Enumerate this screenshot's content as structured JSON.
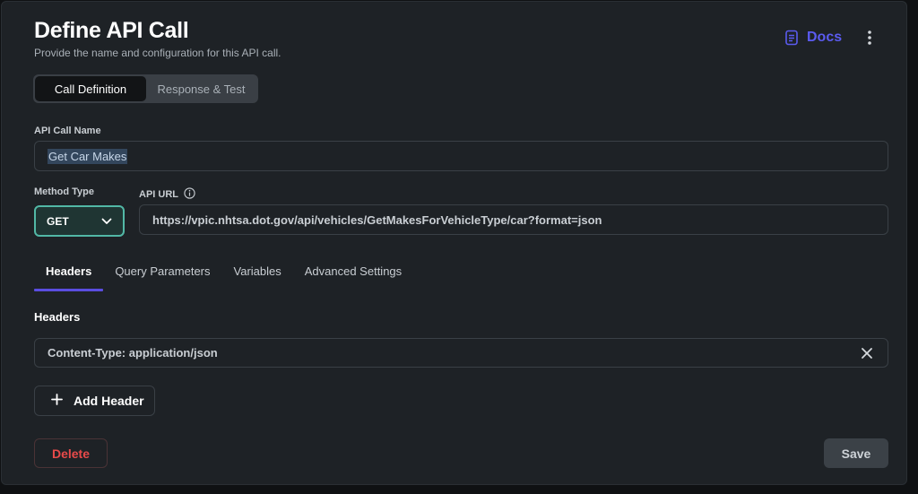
{
  "header": {
    "title": "Define API Call",
    "subtitle": "Provide the name and configuration for this API call.",
    "docs_label": "Docs"
  },
  "segmented": {
    "tabs": [
      {
        "label": "Call Definition",
        "active": true
      },
      {
        "label": "Response & Test",
        "active": false
      }
    ]
  },
  "form": {
    "name_label": "API Call Name",
    "name_value": "Get Car Makes",
    "method_label": "Method Type",
    "method_value": "GET",
    "url_label": "API URL",
    "url_value": "https://vpic.nhtsa.dot.gov/api/vehicles/GetMakesForVehicleType/car?format=json"
  },
  "tabs": [
    {
      "label": "Headers",
      "active": true
    },
    {
      "label": "Query Parameters",
      "active": false
    },
    {
      "label": "Variables",
      "active": false
    },
    {
      "label": "Advanced Settings",
      "active": false
    }
  ],
  "headers_section": {
    "title": "Headers",
    "items": [
      "Content-Type: application/json"
    ],
    "add_label": "Add Header"
  },
  "footer": {
    "delete_label": "Delete",
    "save_label": "Save"
  },
  "icons": {
    "docs": "document-icon",
    "menu": "kebab-menu-icon",
    "info": "info-icon",
    "dropdown": "chevron-down-icon",
    "remove": "close-icon",
    "add": "plus-icon"
  },
  "colors": {
    "accent": "#5b5bf0",
    "tab_indicator": "#5a4de0",
    "method_border": "#52b8a6",
    "danger": "#e84a4a"
  }
}
